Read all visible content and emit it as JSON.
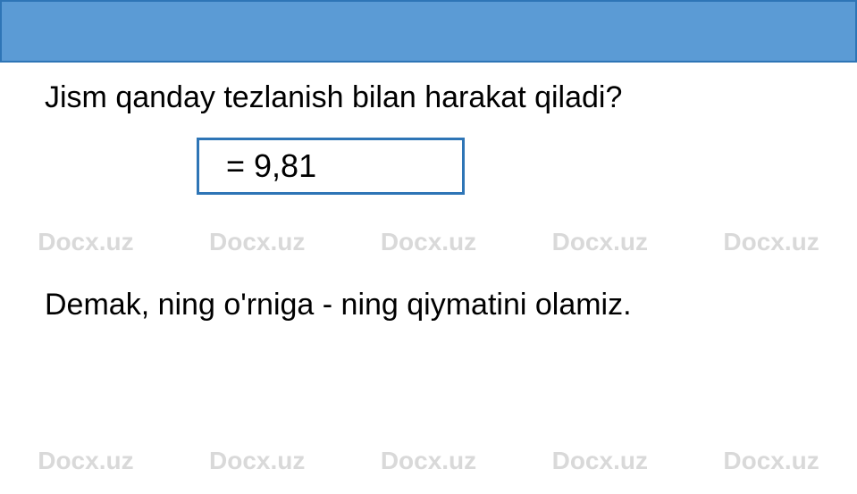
{
  "watermark": "Docx.uz",
  "question": "Jism qanday tezlanish bilan harakat qiladi?",
  "formula": "  =  9,81 ",
  "conclusion": "Demak,   ning  o'rniga  -   ning  qiymatini  olamiz."
}
